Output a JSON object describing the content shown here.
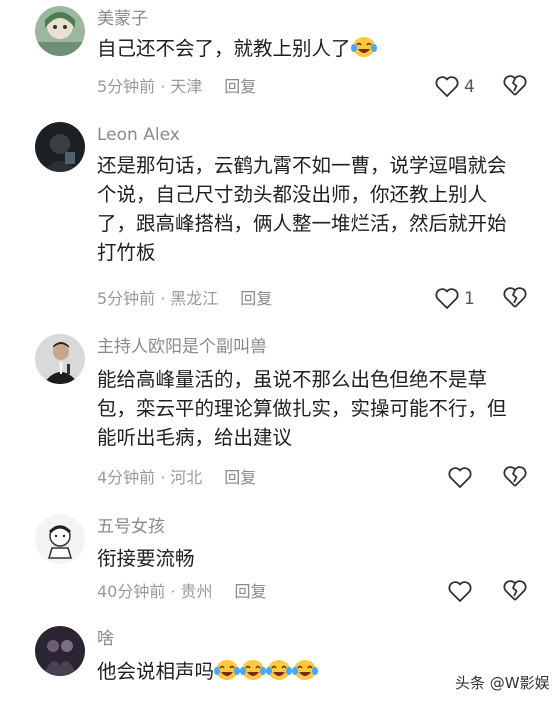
{
  "comments": [
    {
      "username": "美蒙子",
      "lines": [
        "自己还不会了，就教上别人了"
      ],
      "time": "5分钟前",
      "location": "天津",
      "reply": "回复",
      "likes": "4",
      "emoji_count": 1,
      "emoji": "laughing-tears-emoji"
    },
    {
      "username": "Leon Alex",
      "lines": [
        "还是那句话，云鹤九霄不如一曹，说学逗唱就会",
        "个说，自己尺寸劲头都没出师，你还教上别人",
        "了，跟高峰搭档，俩人整一堆烂活，然后就开始",
        "打竹板"
      ],
      "time": "5分钟前",
      "location": "黑龙江",
      "reply": "回复",
      "likes": "1"
    },
    {
      "username": "主持人欧阳是个副叫兽",
      "lines": [
        "能给高峰量活的，虽说不那么出色但绝不是草",
        "包，栾云平的理论算做扎实，实操可能不行，但",
        "能听出毛病，给出建议"
      ],
      "time": "4分钟前",
      "location": "河北",
      "reply": "回复",
      "likes": ""
    },
    {
      "username": "五号女孩",
      "lines": [
        "衔接要流畅"
      ],
      "time": "40分钟前",
      "location": "贵州",
      "reply": "回复",
      "likes": ""
    },
    {
      "username": "啥",
      "lines": [
        "他会说相声吗"
      ],
      "emoji_count": 4,
      "emoji": "laughing-tears-emoji"
    }
  ],
  "watermark": "头条 @W影娱",
  "icons": {
    "like": "heart-outline-icon",
    "dislike": "broken-heart-icon"
  },
  "colors": {
    "meta": "#9a9a9a",
    "username": "#8a8a8a",
    "text": "#1f1f1f"
  }
}
